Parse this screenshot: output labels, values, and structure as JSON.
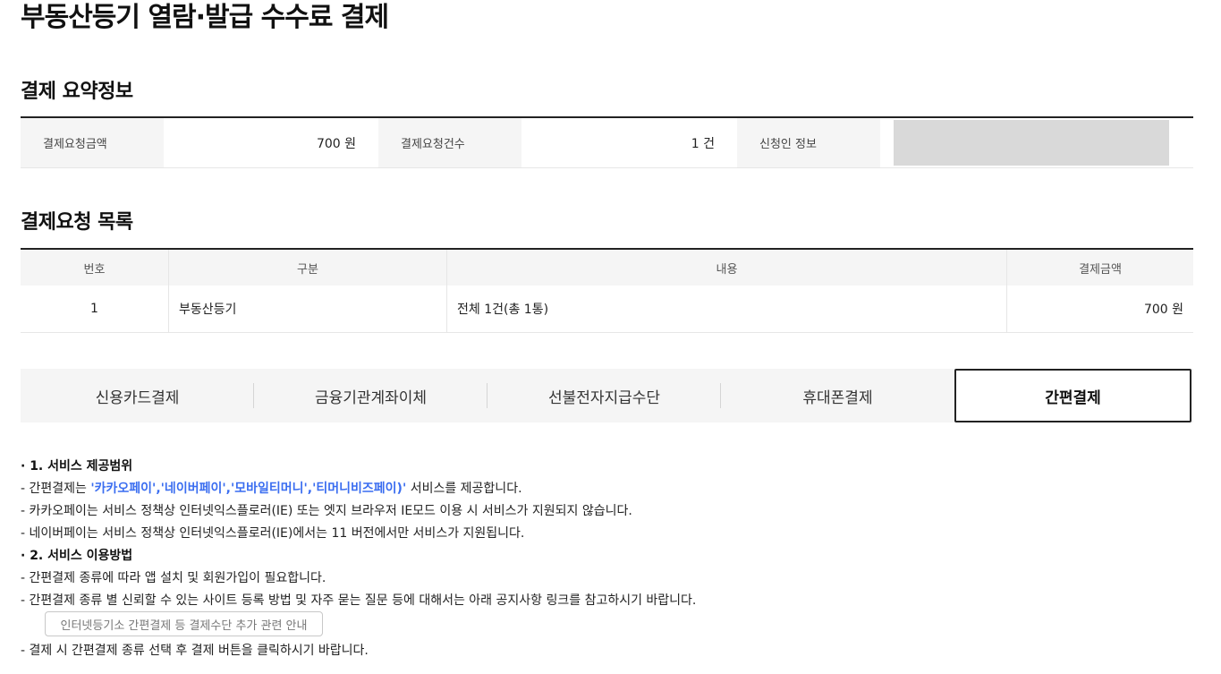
{
  "page": {
    "title": "부동산등기 열람·발급 수수료 결제"
  },
  "summary": {
    "title": "결제 요약정보",
    "amount_label": "결제요청금액",
    "amount_value": "700 원",
    "count_label": "결제요청건수",
    "count_value": "1 건",
    "applicant_label": "신청인 정보"
  },
  "request_list": {
    "title": "결제요청 목록",
    "headers": [
      "번호",
      "구분",
      "내용",
      "결제금액"
    ],
    "rows": [
      {
        "no": "1",
        "category": "부동산등기",
        "content": "전체 1건(총 1통)",
        "amount": "700 원"
      }
    ]
  },
  "payment_tabs": {
    "items": [
      "신용카드결제",
      "금융기관계좌이체",
      "선불전자지급수단",
      "휴대폰결제",
      "간편결제"
    ],
    "selected": "간편결제"
  },
  "info": {
    "s1_title": "· 1. 서비스 제공범위",
    "s1_l1_prefix": " - 간편결제는 ",
    "s1_l1_highlight": "'카카오페이','네이버페이','모바일티머니','티머니비즈페이)'",
    "s1_l1_suffix": " 서비스를 제공합니다.",
    "s1_l2": " - 카카오페이는 서비스 정책상 인터넷익스플로러(IE) 또는 엣지 브라우저 IE모드 이용 시 서비스가 지원되지 않습니다.",
    "s1_l3": " - 네이버페이는 서비스 정책상 인터넷익스플로러(IE)에서는 11 버전에서만 서비스가 지원됩니다.",
    "s2_title": "· 2. 서비스 이용방법",
    "s2_l1": " - 간편결제 종류에 따라 앱 설치 및 회원가입이 필요합니다.",
    "s2_l2": " - 간편결제 종류 별 신뢰할 수 있는 사이트 등록 방법 및 자주 묻는 질문 등에 대해서는 아래 공지사항 링크를 참고하시기 바랍니다.",
    "notice_button": "인터넷등기소 간편결제 등 결제수단 추가 관련 안내",
    "s2_l3": " - 결제 시 간편결제 종류 선택 후 결제 버튼을 클릭하시기 바랍니다."
  }
}
